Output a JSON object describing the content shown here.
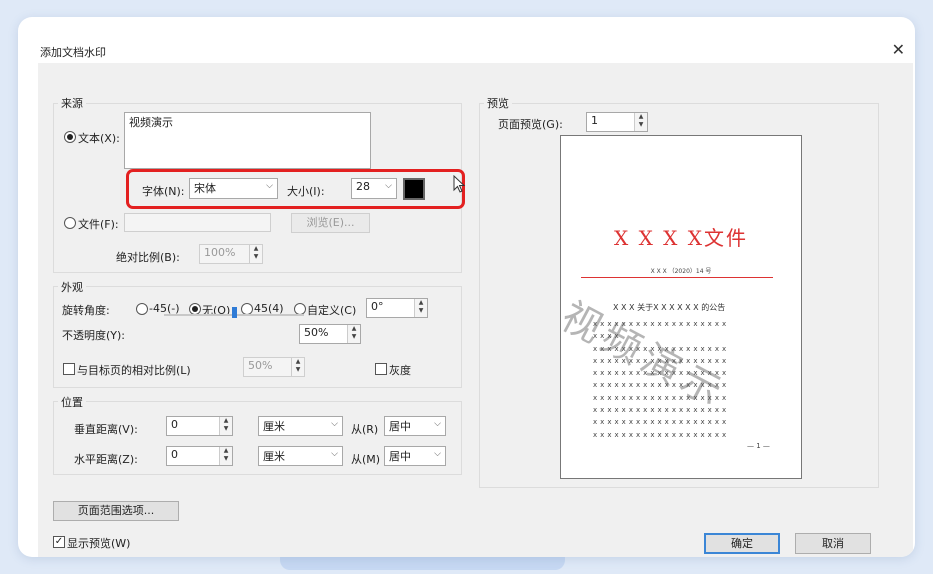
{
  "dialog": {
    "title": "添加文档水印",
    "close_glyph": "✕"
  },
  "source": {
    "label": "来源",
    "text_option": "文本(X):",
    "text_value": "视频演示",
    "font_label": "字体(N):",
    "font_value": "宋体",
    "size_label": "大小(I):",
    "size_value": "28",
    "color_value": "#000000",
    "file_option": "文件(F):",
    "file_value": "",
    "browse_button": "浏览(E)...",
    "scale_label": "绝对比例(B):",
    "scale_value": "100%"
  },
  "appearance": {
    "label": "外观",
    "rotation_label": "旋转角度:",
    "rotation_options": [
      "-45(-)",
      "无(O)",
      "45(4)",
      "自定义(C)"
    ],
    "rotation_selected": "无(O)",
    "custom_angle": "0°",
    "opacity_label": "不透明度(Y):",
    "opacity_value": "50%",
    "opacity_level": 0.5,
    "relative_scale_label": "与目标页的相对比例(L)",
    "relative_scale_value": "50%",
    "grayscale_label": "灰度"
  },
  "position": {
    "label": "位置",
    "vertical_label": "垂直距离(V):",
    "vertical_value": "0",
    "vertical_unit": "厘米",
    "vertical_from_label": "从(R)",
    "vertical_from_value": "居中",
    "horizontal_label": "水平距离(Z):",
    "horizontal_value": "0",
    "horizontal_unit": "厘米",
    "horizontal_from_label": "从(M)",
    "horizontal_from_value": "居中"
  },
  "page_range_button": "页面范围选项...",
  "show_preview_label": "显示预览(W)",
  "preview": {
    "label": "预览",
    "page_label": "页面预览(G):",
    "page_value": "1",
    "doc_title": "X X X X文件",
    "doc_number": "X X X （2020）14 号",
    "doc_subtitle": "X X X 关于X X X X X X 的公告",
    "doc_body_lines": [
      "x x x x x x x x x x x x x x x x x x x",
      "x x x x",
      "x x x x x x x x x x x x x x x x x x x",
      "x x x x x x x x x x x x x x x x x x x",
      "x x x x x x x x x x x x x x x x x x x",
      "x x x x x x x x x x x x x x x x x x x",
      "x x x x x x x x x x x x x x x x x x x",
      "x x x x x x x x x x x x x x x x x x x",
      "x x x x x x x x x x x x x x x x x x x",
      "x x x x x x x x x x x x x x x x x x x"
    ],
    "doc_page_number": "— 1 —",
    "watermark_text": "视频演示"
  },
  "buttons": {
    "ok": "确定",
    "cancel": "取消"
  },
  "colors": {
    "highlight": "#e32020",
    "watermark": "#5a5a5a",
    "doc_red": "#dd3333",
    "accent": "#2f7bd6"
  }
}
